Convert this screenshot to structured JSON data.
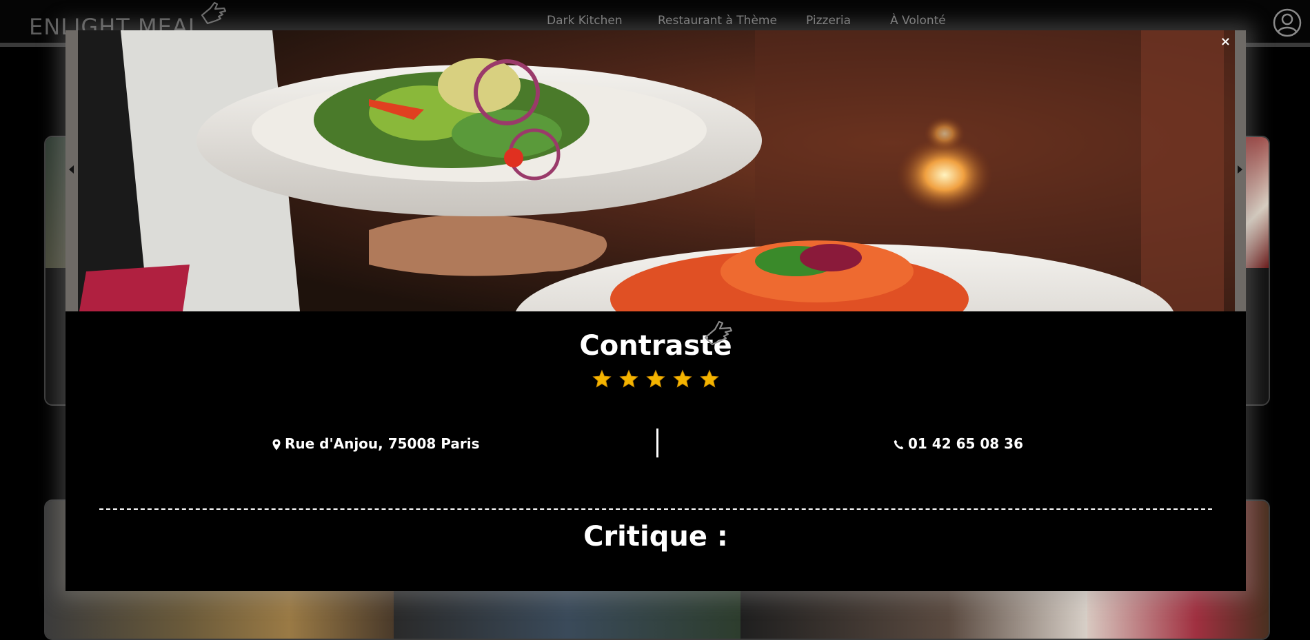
{
  "header": {
    "logo": "ENLIGHT MEAL",
    "nav": [
      "Dark Kitchen",
      "Restaurant à Thème",
      "Pizzeria",
      "À Volonté"
    ],
    "account_icon": "user-circle-icon"
  },
  "modal": {
    "close_label": "×",
    "restaurant_name": "Contraste",
    "rating": 5,
    "rating_max": 5,
    "address": "Rue d'Anjou, 75008 Paris",
    "address_icon": "map-pin-icon",
    "phone": "01 42 65 08 36",
    "phone_icon": "phone-icon",
    "critique_title": "Critique :"
  },
  "colors": {
    "background": "#000000",
    "nav_text": "#7b7b7b",
    "star": "#f4b400",
    "modal_glow": "#a0a0a0"
  }
}
